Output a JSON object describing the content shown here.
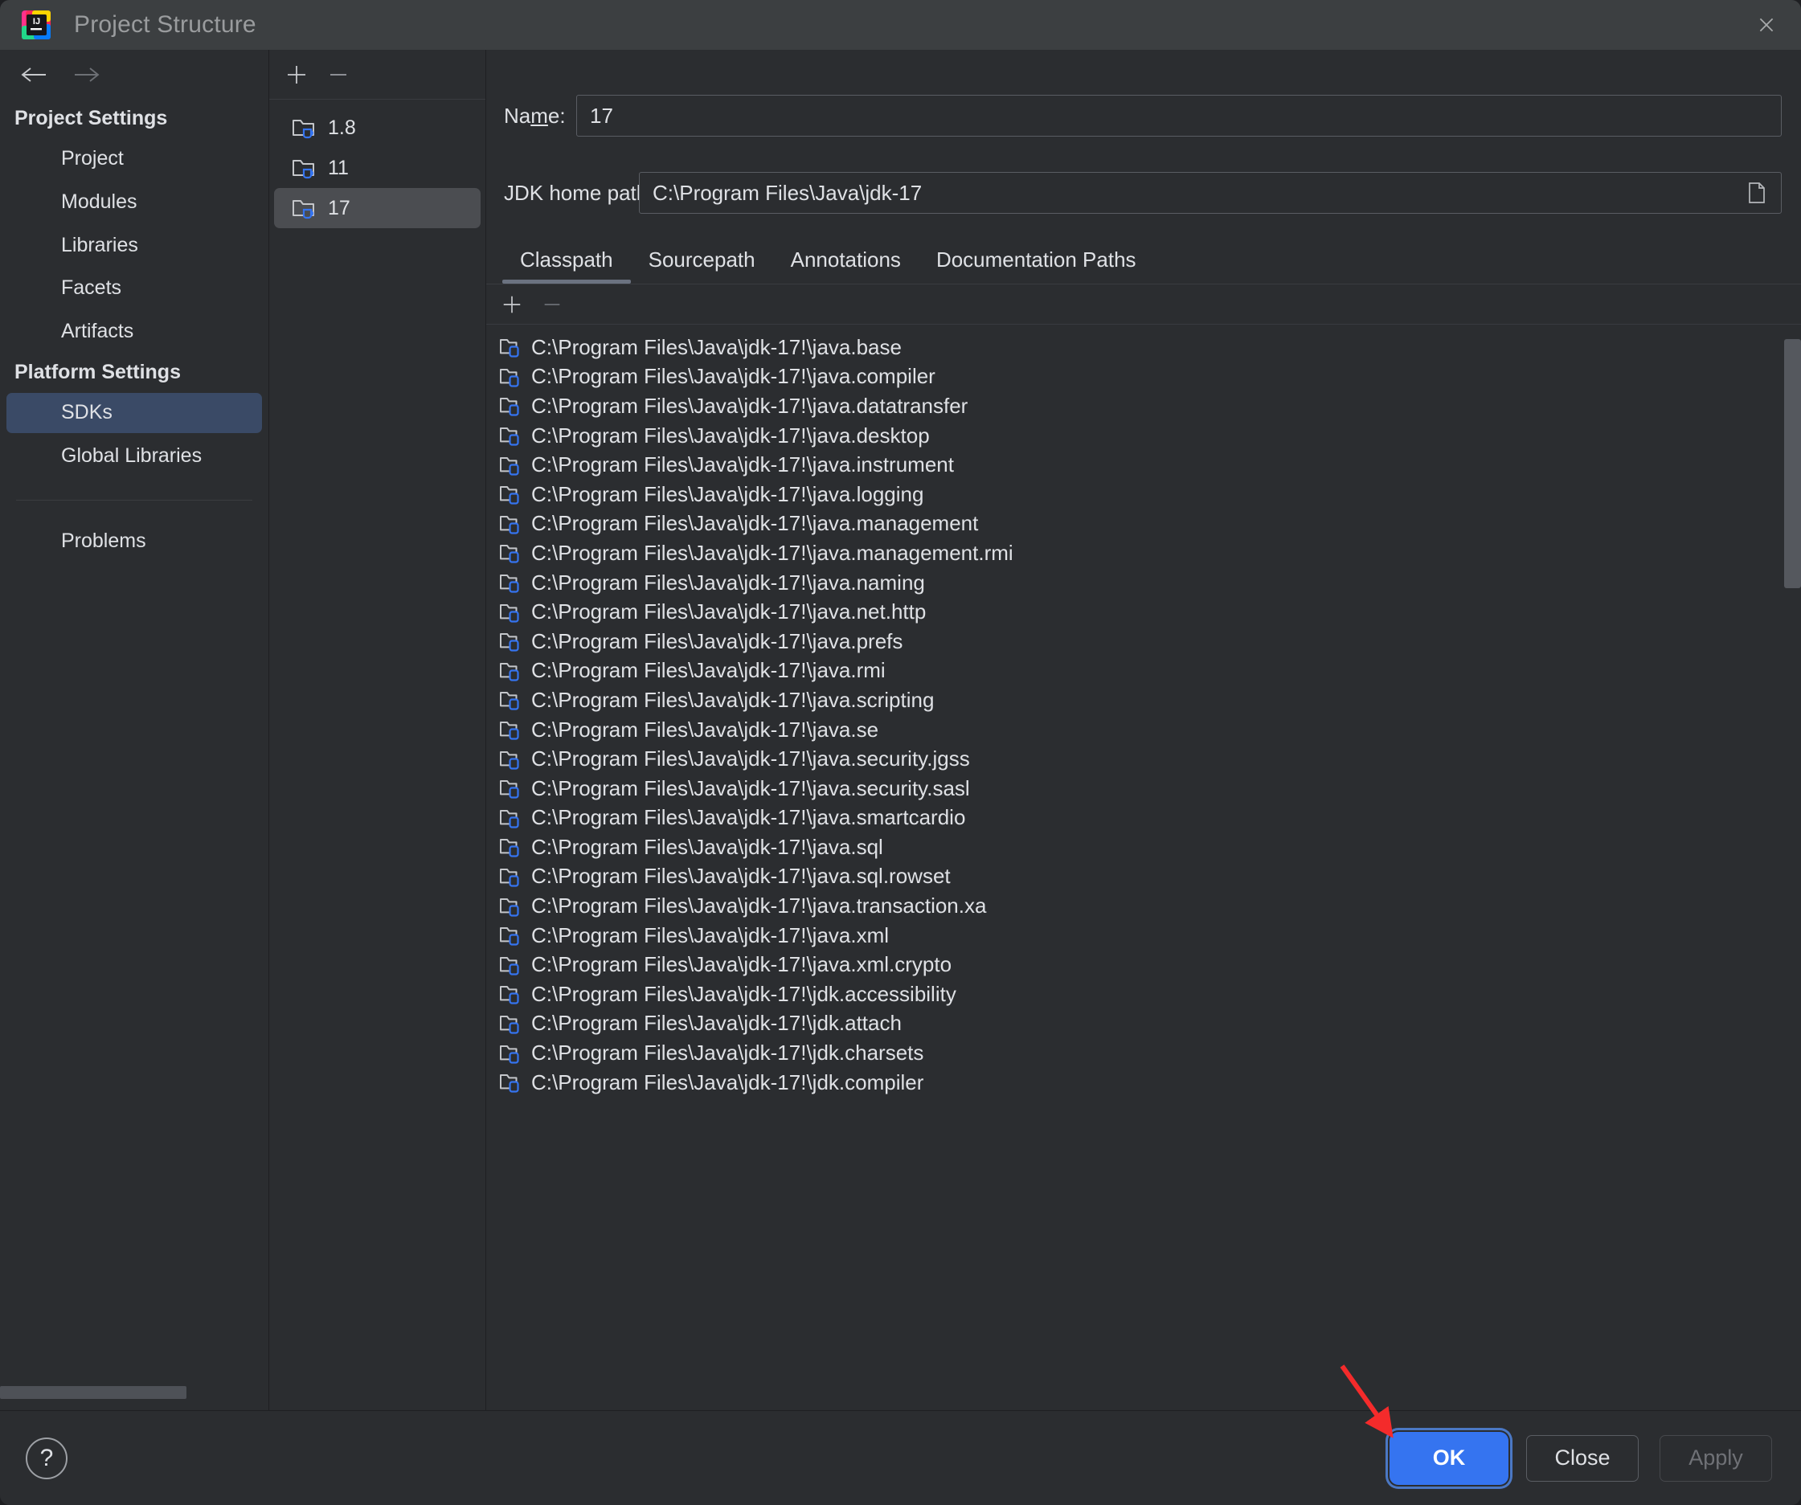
{
  "window": {
    "title": "Project Structure",
    "app_icon": "intellij-idea-icon",
    "close_icon": "close-icon"
  },
  "nav": {
    "back_icon": "arrow-left-icon",
    "forward_icon": "arrow-right-icon",
    "groups": [
      {
        "title": "Project Settings",
        "items": [
          {
            "label": "Project",
            "selected": false
          },
          {
            "label": "Modules",
            "selected": false
          },
          {
            "label": "Libraries",
            "selected": false
          },
          {
            "label": "Facets",
            "selected": false
          },
          {
            "label": "Artifacts",
            "selected": false
          }
        ]
      },
      {
        "title": "Platform Settings",
        "items": [
          {
            "label": "SDKs",
            "selected": true
          },
          {
            "label": "Global Libraries",
            "selected": false
          }
        ]
      }
    ],
    "problems_label": "Problems"
  },
  "sdk_panel": {
    "add_icon": "plus-icon",
    "remove_icon": "minus-icon",
    "items": [
      {
        "label": "1.8",
        "icon": "jdk-folder-icon",
        "selected": false
      },
      {
        "label": "11",
        "icon": "jdk-folder-icon",
        "selected": false
      },
      {
        "label": "17",
        "icon": "jdk-folder-icon",
        "selected": true
      }
    ]
  },
  "details": {
    "name_label": "Name:",
    "name_value": "17",
    "jdk_home_label": "JDK home path:",
    "jdk_home_value": "C:\\Program Files\\Java\\jdk-17",
    "browse_icon": "file-browse-icon",
    "tabs": [
      {
        "label": "Classpath",
        "active": true
      },
      {
        "label": "Sourcepath",
        "active": false
      },
      {
        "label": "Annotations",
        "active": false
      },
      {
        "label": "Documentation Paths",
        "active": false
      }
    ],
    "list_toolbar": {
      "add_icon": "plus-icon",
      "remove_icon": "minus-icon"
    },
    "classpath_entries": [
      "C:\\Program Files\\Java\\jdk-17!\\java.base",
      "C:\\Program Files\\Java\\jdk-17!\\java.compiler",
      "C:\\Program Files\\Java\\jdk-17!\\java.datatransfer",
      "C:\\Program Files\\Java\\jdk-17!\\java.desktop",
      "C:\\Program Files\\Java\\jdk-17!\\java.instrument",
      "C:\\Program Files\\Java\\jdk-17!\\java.logging",
      "C:\\Program Files\\Java\\jdk-17!\\java.management",
      "C:\\Program Files\\Java\\jdk-17!\\java.management.rmi",
      "C:\\Program Files\\Java\\jdk-17!\\java.naming",
      "C:\\Program Files\\Java\\jdk-17!\\java.net.http",
      "C:\\Program Files\\Java\\jdk-17!\\java.prefs",
      "C:\\Program Files\\Java\\jdk-17!\\java.rmi",
      "C:\\Program Files\\Java\\jdk-17!\\java.scripting",
      "C:\\Program Files\\Java\\jdk-17!\\java.se",
      "C:\\Program Files\\Java\\jdk-17!\\java.security.jgss",
      "C:\\Program Files\\Java\\jdk-17!\\java.security.sasl",
      "C:\\Program Files\\Java\\jdk-17!\\java.smartcardio",
      "C:\\Program Files\\Java\\jdk-17!\\java.sql",
      "C:\\Program Files\\Java\\jdk-17!\\java.sql.rowset",
      "C:\\Program Files\\Java\\jdk-17!\\java.transaction.xa",
      "C:\\Program Files\\Java\\jdk-17!\\java.xml",
      "C:\\Program Files\\Java\\jdk-17!\\java.xml.crypto",
      "C:\\Program Files\\Java\\jdk-17!\\jdk.accessibility",
      "C:\\Program Files\\Java\\jdk-17!\\jdk.attach",
      "C:\\Program Files\\Java\\jdk-17!\\jdk.charsets",
      "C:\\Program Files\\Java\\jdk-17!\\jdk.compiler"
    ]
  },
  "footer": {
    "help_icon": "question-mark-icon",
    "help_label": "?",
    "ok_label": "OK",
    "close_label": "Close",
    "apply_label": "Apply"
  },
  "annotation": {
    "arrow_icon": "red-arrow-pointing-to-ok",
    "color": "#f42b2b"
  },
  "colors": {
    "accent": "#3574f0",
    "selection": "#3a4a66",
    "window_bg": "#2b2d30",
    "titlebar_bg": "#3c3f41",
    "text": "#dfe1e5"
  }
}
